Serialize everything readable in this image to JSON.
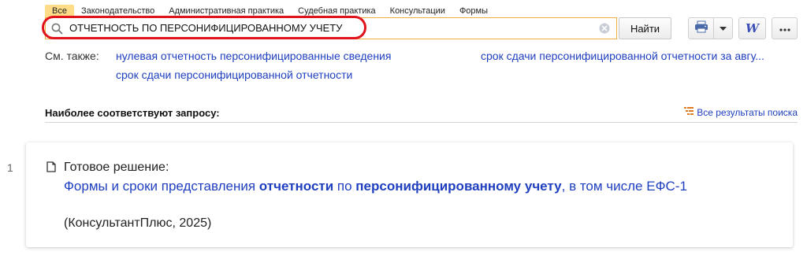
{
  "tabs": [
    {
      "label": "Все",
      "active": true
    },
    {
      "label": "Законодательство"
    },
    {
      "label": "Административная практика"
    },
    {
      "label": "Судебная практика"
    },
    {
      "label": "Консультации"
    },
    {
      "label": "Формы"
    }
  ],
  "search": {
    "query": "ОТЧЕТНОСТЬ ПО ПЕРСОНИФИЦИРОВАННОМУ УЧЕТУ",
    "find_label": "Найти"
  },
  "toolbar": {
    "print_icon": "printer-icon",
    "dropdown_icon": "chevron-down-icon",
    "word_label": "W",
    "more_label": "•••"
  },
  "see_also": {
    "label": "См. также:",
    "links": [
      "нулевая отчетность персонифицированные сведения",
      "срок сдачи персонифицированной отчетности за авгу...",
      "срок сдачи персонифицированной отчетности"
    ]
  },
  "results_header": {
    "heading": "Наиболее соответствуют запросу:",
    "all_results": "Все результаты поиска"
  },
  "results": [
    {
      "index": "1",
      "type": "Готовое решение:",
      "title_parts": [
        {
          "text": "Формы и сроки представления ",
          "bold": false
        },
        {
          "text": "отчетности",
          "bold": true
        },
        {
          "text": " по ",
          "bold": false
        },
        {
          "text": "персонифицированному",
          "bold": true
        },
        {
          "text": " ",
          "bold": false
        },
        {
          "text": "учету",
          "bold": true
        },
        {
          "text": ", в том числе ЕФС-1",
          "bold": false
        }
      ],
      "source": "(КонсультантПлюс, 2025)"
    }
  ],
  "colors": {
    "accent": "#ffdd88",
    "highlight_oval": "#e0121b",
    "link": "#1f3fbf",
    "search_border": "#f0b040"
  }
}
